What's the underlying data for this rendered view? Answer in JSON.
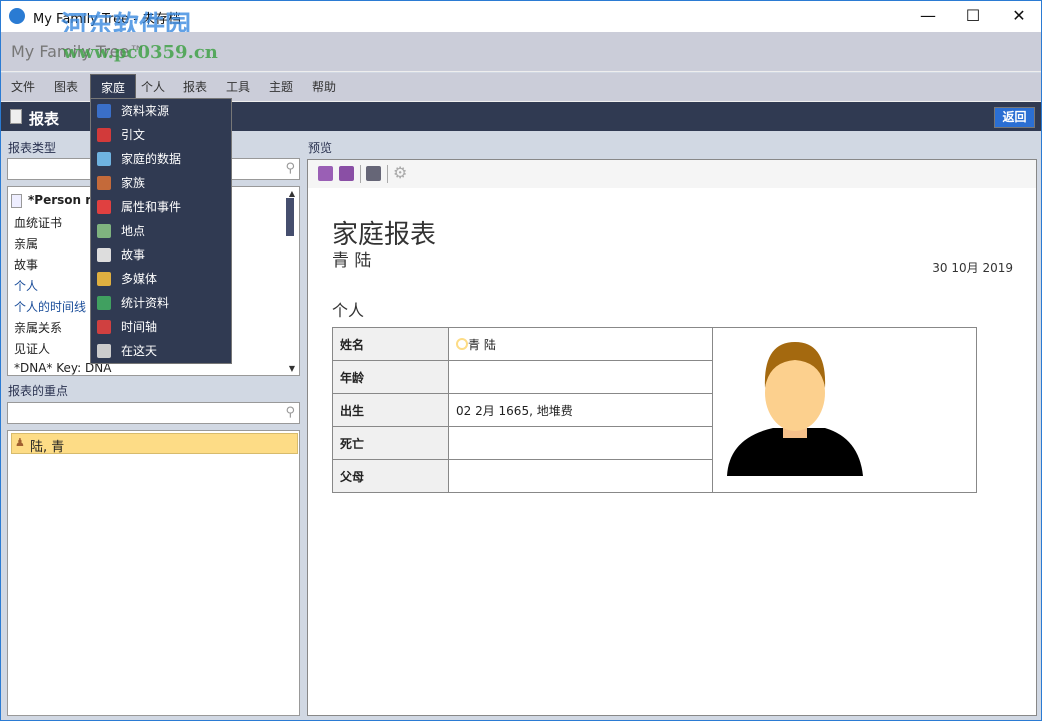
{
  "window": {
    "title": "My Family Tree - 未存档",
    "minimize_icon": "minimize-icon",
    "maximize_icon": "maximize-icon",
    "close_icon": "close-icon"
  },
  "header": {
    "app_name": "My Family Tree™"
  },
  "watermark": {
    "line1": "河东软件园",
    "line2": "www.pc0359.cn"
  },
  "menu": [
    "文件",
    "图表",
    "家庭",
    "个人",
    "报表",
    "工具",
    "主题",
    "帮助"
  ],
  "menu_active": "家庭",
  "dropdown": [
    {
      "label": "资料来源",
      "icon": "sources-icon",
      "color": "#3a6fc8"
    },
    {
      "label": "引文",
      "icon": "citation-icon",
      "color": "#d23a3a"
    },
    {
      "label": "家庭的数据",
      "icon": "table-icon",
      "color": "#6fb3e0"
    },
    {
      "label": "家族",
      "icon": "family-icon",
      "color": "#c46a3a"
    },
    {
      "label": "属性和事件",
      "icon": "calendar-icon",
      "color": "#e04040"
    },
    {
      "label": "地点",
      "icon": "map-icon",
      "color": "#7fb37f"
    },
    {
      "label": "故事",
      "icon": "documents-icon",
      "color": "#dddddd"
    },
    {
      "label": "多媒体",
      "icon": "media-icon",
      "color": "#e0b040"
    },
    {
      "label": "统计资料",
      "icon": "chart-icon",
      "color": "#40a060"
    },
    {
      "label": "时间轴",
      "icon": "timeline-icon",
      "color": "#d04040"
    },
    {
      "label": "在这天",
      "icon": "calendar-day-icon",
      "color": "#cccccc"
    }
  ],
  "page": {
    "title": "报表",
    "back_label": "返回"
  },
  "left": {
    "report_types_label": "报表类型",
    "report_types_search": "",
    "report_types": [
      {
        "label": "*Person rep",
        "blue": false,
        "bold": true
      },
      {
        "label": "血统证书",
        "blue": false
      },
      {
        "label": "亲属",
        "blue": false
      },
      {
        "label": "故事",
        "blue": false
      },
      {
        "label": "个人",
        "blue": true
      },
      {
        "label": "个人的时间线",
        "blue": true
      },
      {
        "label": "亲属关系",
        "blue": false
      },
      {
        "label": "见证人",
        "blue": false
      },
      {
        "label": "*DNA* Key: DNA",
        "blue": false
      }
    ],
    "focus_label": "报表的重点",
    "focus_search": "",
    "focus_items": [
      "陆, 青"
    ]
  },
  "preview": {
    "label": "预览",
    "report_title": "家庭报表",
    "subject": "青 陆",
    "date": "30 10月 2019",
    "section": "个人",
    "rows": [
      {
        "key": "姓名",
        "value": "青 陆"
      },
      {
        "key": "年龄",
        "value": ""
      },
      {
        "key": "出生",
        "value": "02 2月 1665, 地堆费"
      },
      {
        "key": "死亡",
        "value": ""
      },
      {
        "key": "父母",
        "value": ""
      }
    ]
  }
}
